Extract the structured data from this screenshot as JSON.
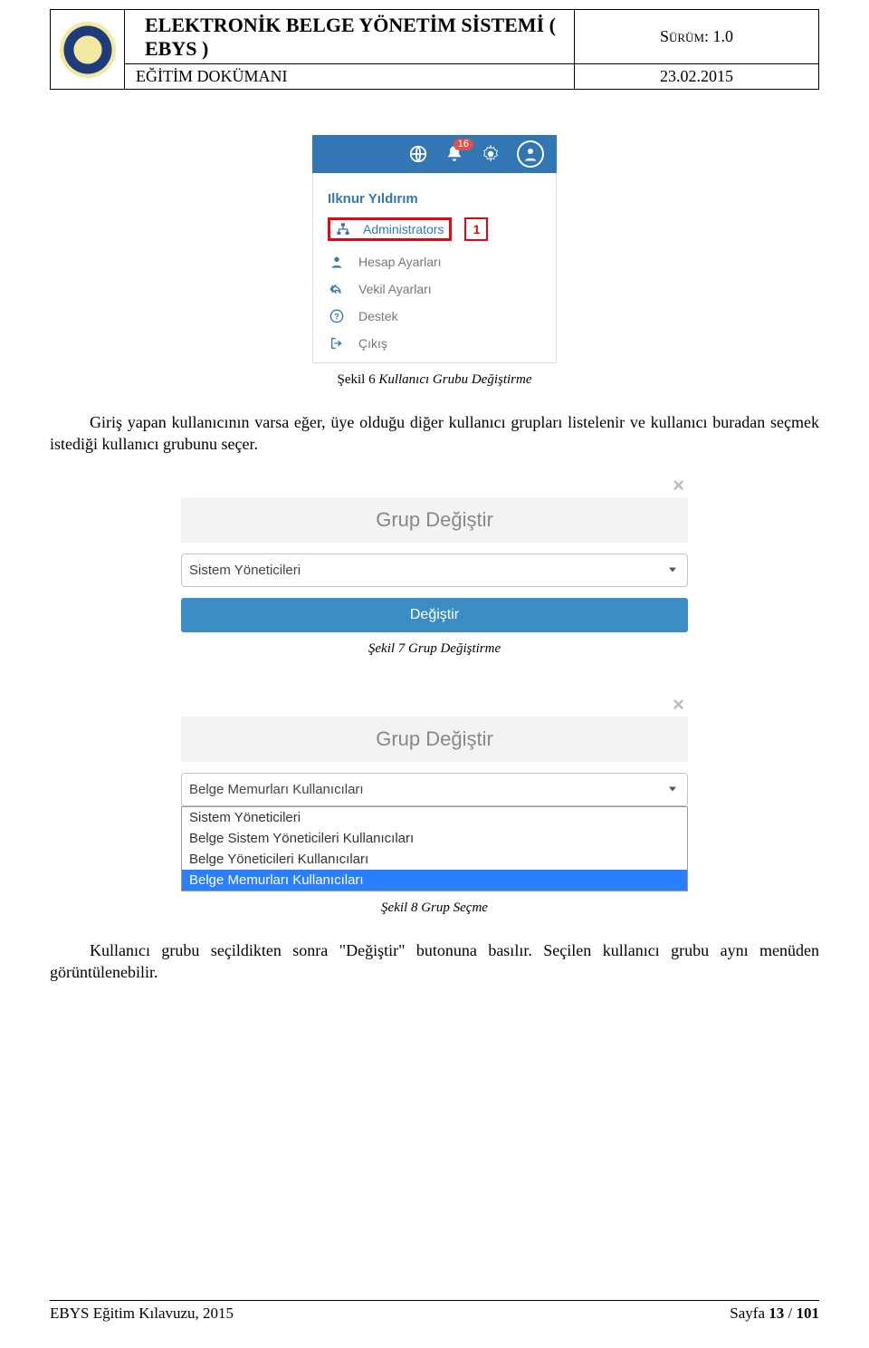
{
  "header": {
    "title": "ELEKTRONİK BELGE YÖNETİM SİSTEMİ ( EBYS )",
    "version_label": "Sürüm:",
    "version_value": "1.0",
    "doc_type": "EĞİTİM DOKÜMANI",
    "date": "23.02.2015"
  },
  "menu": {
    "notification_count": "16",
    "username": "Ilknur Yıldırım",
    "admin_label": "Administrators",
    "annotation_number": "1",
    "items": {
      "account": "Hesap Ayarları",
      "delegate": "Vekil Ayarları",
      "support": "Destek",
      "logout": "Çıkış"
    }
  },
  "captions": {
    "fig6_prefix": "Şekil 6",
    "fig6_text": "Kullanıcı Grubu Değiştirme",
    "fig7_prefix": "Şekil 7",
    "fig7_text": "Grup Değiştirme",
    "fig8_prefix": "Şekil 8",
    "fig8_text": "Grup Seçme"
  },
  "paragraphs": {
    "p1": "Giriş yapan kullanıcının varsa eğer, üye olduğu diğer kullanıcı grupları listelenir ve kullanıcı buradan seçmek istediği kullanıcı grubunu seçer.",
    "p2": "Kullanıcı grubu seçildikten sonra \"Değiştir\" butonuna basılır.  Seçilen kullanıcı grubu aynı menüden görüntülenebilir."
  },
  "modal1": {
    "title": "Grup Değiştir",
    "selected": "Sistem Yöneticileri",
    "button": "Değiştir"
  },
  "modal2": {
    "title": "Grup Değiştir",
    "selected": "Belge Memurları Kullanıcıları",
    "options": {
      "o1": "Sistem Yöneticileri",
      "o2": "Belge Sistem Yöneticileri Kullanıcıları",
      "o3": "Belge Yöneticileri Kullanıcıları",
      "o4": "Belge Memurları Kullanıcıları"
    }
  },
  "footer": {
    "left": "EBYS Eğitim Kılavuzu, 2015",
    "right_label": "Sayfa ",
    "page": "13",
    "sep": " / ",
    "total": "101"
  }
}
